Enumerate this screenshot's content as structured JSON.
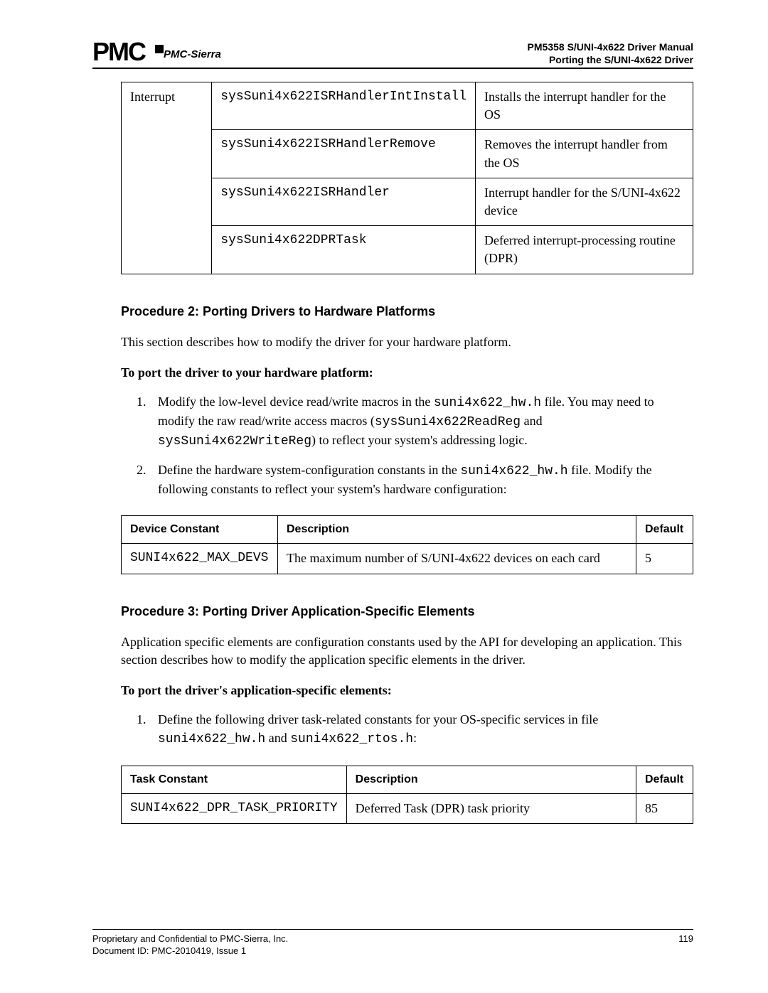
{
  "header": {
    "logo_company": "PMC-Sierra",
    "title_line1": "PM5358 S/UNI-4x622 Driver Manual",
    "title_line2": "Porting the S/UNI-4x622 Driver"
  },
  "table1": {
    "col1_rowspan_label": "Interrupt",
    "rows": [
      {
        "fn": "sysSuni4x622ISRHandlerIntInstall",
        "desc": "Installs the interrupt handler for the OS"
      },
      {
        "fn": "sysSuni4x622ISRHandlerRemove",
        "desc": "Removes the interrupt handler from the OS"
      },
      {
        "fn": "sysSuni4x622ISRHandler",
        "desc": "Interrupt handler for the S/UNI-4x622 device"
      },
      {
        "fn": "sysSuni4x622DPRTask",
        "desc": "Deferred interrupt-processing routine (DPR)"
      }
    ]
  },
  "proc2": {
    "heading": "Procedure 2: Porting Drivers to Hardware Platforms",
    "intro": "This section describes how to modify the driver for your hardware platform.",
    "subheading": "To port the driver to your hardware platform:",
    "step1_a": "Modify the low-level device read/write macros in the ",
    "step1_code1": "suni4x622_hw.h",
    "step1_b": " file. You may need to modify the raw read/write access macros (",
    "step1_code2": "sysSuni4x622ReadReg",
    "step1_c": " and ",
    "step1_code3": "sysSuni4x622WriteReg",
    "step1_d": ") to reflect your system's addressing logic.",
    "step2_a": "Define the hardware system-configuration constants in the ",
    "step2_code1": "suni4x622_hw.h",
    "step2_b": " file. Modify the following constants to reflect your system's hardware configuration:"
  },
  "table2": {
    "h1": "Device Constant",
    "h2": "Description",
    "h3": "Default",
    "row": {
      "c1": "SUNI4x622_MAX_DEVS",
      "c2": "The maximum number of S/UNI-4x622 devices on each card",
      "c3": "5"
    }
  },
  "proc3": {
    "heading": "Procedure 3: Porting Driver Application-Specific Elements",
    "intro": "Application specific elements are configuration constants used by the API for developing an application. This section describes how to modify the application specific elements in the driver.",
    "subheading": "To port the driver's application-specific elements:",
    "step1_a": "Define the following driver task-related constants for your OS-specific services in file ",
    "step1_code1": "suni4x622_hw.h",
    "step1_b": " and ",
    "step1_code2": "suni4x622_rtos.h",
    "step1_c": ":"
  },
  "table3": {
    "h1": "Task Constant",
    "h2": "Description",
    "h3": "Default",
    "row": {
      "c1": "SUNI4x622_DPR_TASK_PRIORITY",
      "c2": "Deferred Task (DPR) task priority",
      "c3": "85"
    }
  },
  "footer": {
    "line1": "Proprietary and Confidential to PMC-Sierra, Inc.",
    "line2": "Document ID: PMC-2010419, Issue 1",
    "page": "119"
  }
}
